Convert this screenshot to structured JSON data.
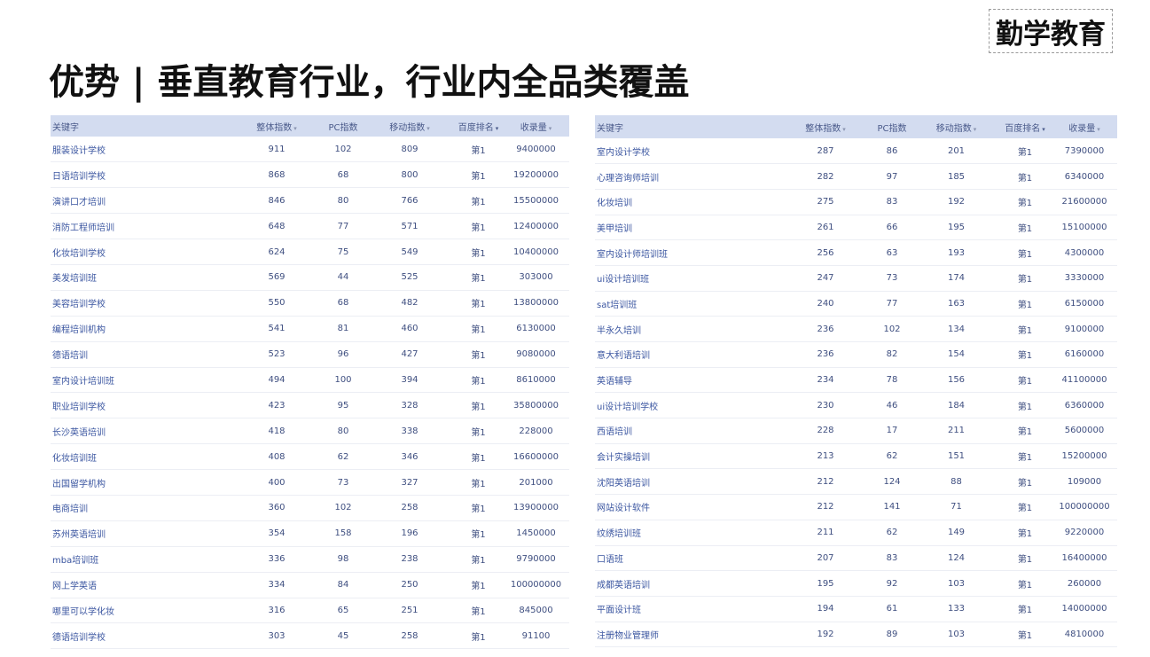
{
  "logo": "勤学教育",
  "title": "优势 | 垂直教育行业，行业内全品类覆盖",
  "headers": {
    "keyword": "关键字",
    "overall": "整体指数",
    "pc": "PC指数",
    "mobile": "移动指数",
    "rank": "百度排名",
    "indexed": "收录量",
    "sort_caret": "▾"
  },
  "left_rows": [
    {
      "kw": "服装设计学校",
      "overall": "911",
      "pc": "102",
      "mobile": "809",
      "rank": "第1",
      "indexed": "9400000"
    },
    {
      "kw": "日语培训学校",
      "overall": "868",
      "pc": "68",
      "mobile": "800",
      "rank": "第1",
      "indexed": "19200000"
    },
    {
      "kw": "演讲口才培训",
      "overall": "846",
      "pc": "80",
      "mobile": "766",
      "rank": "第1",
      "indexed": "15500000"
    },
    {
      "kw": "消防工程师培训",
      "overall": "648",
      "pc": "77",
      "mobile": "571",
      "rank": "第1",
      "indexed": "12400000"
    },
    {
      "kw": "化妆培训学校",
      "overall": "624",
      "pc": "75",
      "mobile": "549",
      "rank": "第1",
      "indexed": "10400000"
    },
    {
      "kw": "美发培训班",
      "overall": "569",
      "pc": "44",
      "mobile": "525",
      "rank": "第1",
      "indexed": "303000"
    },
    {
      "kw": "美容培训学校",
      "overall": "550",
      "pc": "68",
      "mobile": "482",
      "rank": "第1",
      "indexed": "13800000"
    },
    {
      "kw": "编程培训机构",
      "overall": "541",
      "pc": "81",
      "mobile": "460",
      "rank": "第1",
      "indexed": "6130000"
    },
    {
      "kw": "德语培训",
      "overall": "523",
      "pc": "96",
      "mobile": "427",
      "rank": "第1",
      "indexed": "9080000"
    },
    {
      "kw": "室内设计培训班",
      "overall": "494",
      "pc": "100",
      "mobile": "394",
      "rank": "第1",
      "indexed": "8610000"
    },
    {
      "kw": "职业培训学校",
      "overall": "423",
      "pc": "95",
      "mobile": "328",
      "rank": "第1",
      "indexed": "35800000"
    },
    {
      "kw": "长沙英语培训",
      "overall": "418",
      "pc": "80",
      "mobile": "338",
      "rank": "第1",
      "indexed": "228000"
    },
    {
      "kw": "化妆培训班",
      "overall": "408",
      "pc": "62",
      "mobile": "346",
      "rank": "第1",
      "indexed": "16600000"
    },
    {
      "kw": "出国留学机构",
      "overall": "400",
      "pc": "73",
      "mobile": "327",
      "rank": "第1",
      "indexed": "201000"
    },
    {
      "kw": "电商培训",
      "overall": "360",
      "pc": "102",
      "mobile": "258",
      "rank": "第1",
      "indexed": "13900000"
    },
    {
      "kw": "苏州英语培训",
      "overall": "354",
      "pc": "158",
      "mobile": "196",
      "rank": "第1",
      "indexed": "1450000"
    },
    {
      "kw": "mba培训班",
      "overall": "336",
      "pc": "98",
      "mobile": "238",
      "rank": "第1",
      "indexed": "9790000"
    },
    {
      "kw": "网上学英语",
      "overall": "334",
      "pc": "84",
      "mobile": "250",
      "rank": "第1",
      "indexed": "100000000"
    },
    {
      "kw": "哪里可以学化妆",
      "overall": "316",
      "pc": "65",
      "mobile": "251",
      "rank": "第1",
      "indexed": "845000"
    },
    {
      "kw": "德语培训学校",
      "overall": "303",
      "pc": "45",
      "mobile": "258",
      "rank": "第1",
      "indexed": "91100"
    }
  ],
  "right_rows": [
    {
      "kw": "室内设计学校",
      "overall": "287",
      "pc": "86",
      "mobile": "201",
      "rank": "第1",
      "indexed": "7390000"
    },
    {
      "kw": "心理咨询师培训",
      "overall": "282",
      "pc": "97",
      "mobile": "185",
      "rank": "第1",
      "indexed": "6340000"
    },
    {
      "kw": "化妆培训",
      "overall": "275",
      "pc": "83",
      "mobile": "192",
      "rank": "第1",
      "indexed": "21600000"
    },
    {
      "kw": "美甲培训",
      "overall": "261",
      "pc": "66",
      "mobile": "195",
      "rank": "第1",
      "indexed": "15100000"
    },
    {
      "kw": "室内设计师培训班",
      "overall": "256",
      "pc": "63",
      "mobile": "193",
      "rank": "第1",
      "indexed": "4300000"
    },
    {
      "kw": "ui设计培训班",
      "overall": "247",
      "pc": "73",
      "mobile": "174",
      "rank": "第1",
      "indexed": "3330000"
    },
    {
      "kw": "sat培训班",
      "overall": "240",
      "pc": "77",
      "mobile": "163",
      "rank": "第1",
      "indexed": "6150000"
    },
    {
      "kw": "半永久培训",
      "overall": "236",
      "pc": "102",
      "mobile": "134",
      "rank": "第1",
      "indexed": "9100000"
    },
    {
      "kw": "意大利语培训",
      "overall": "236",
      "pc": "82",
      "mobile": "154",
      "rank": "第1",
      "indexed": "6160000"
    },
    {
      "kw": "英语辅导",
      "overall": "234",
      "pc": "78",
      "mobile": "156",
      "rank": "第1",
      "indexed": "41100000"
    },
    {
      "kw": "ui设计培训学校",
      "overall": "230",
      "pc": "46",
      "mobile": "184",
      "rank": "第1",
      "indexed": "6360000"
    },
    {
      "kw": "西语培训",
      "overall": "228",
      "pc": "17",
      "mobile": "211",
      "rank": "第1",
      "indexed": "5600000"
    },
    {
      "kw": "会计实操培训",
      "overall": "213",
      "pc": "62",
      "mobile": "151",
      "rank": "第1",
      "indexed": "15200000"
    },
    {
      "kw": "沈阳英语培训",
      "overall": "212",
      "pc": "124",
      "mobile": "88",
      "rank": "第1",
      "indexed": "109000"
    },
    {
      "kw": "网站设计软件",
      "overall": "212",
      "pc": "141",
      "mobile": "71",
      "rank": "第1",
      "indexed": "100000000"
    },
    {
      "kw": "纹绣培训班",
      "overall": "211",
      "pc": "62",
      "mobile": "149",
      "rank": "第1",
      "indexed": "9220000"
    },
    {
      "kw": "口语班",
      "overall": "207",
      "pc": "83",
      "mobile": "124",
      "rank": "第1",
      "indexed": "16400000"
    },
    {
      "kw": "成都英语培训",
      "overall": "195",
      "pc": "92",
      "mobile": "103",
      "rank": "第1",
      "indexed": "260000"
    },
    {
      "kw": "平面设计班",
      "overall": "194",
      "pc": "61",
      "mobile": "133",
      "rank": "第1",
      "indexed": "14000000"
    },
    {
      "kw": "注册物业管理师",
      "overall": "192",
      "pc": "89",
      "mobile": "103",
      "rank": "第1",
      "indexed": "4810000"
    }
  ]
}
